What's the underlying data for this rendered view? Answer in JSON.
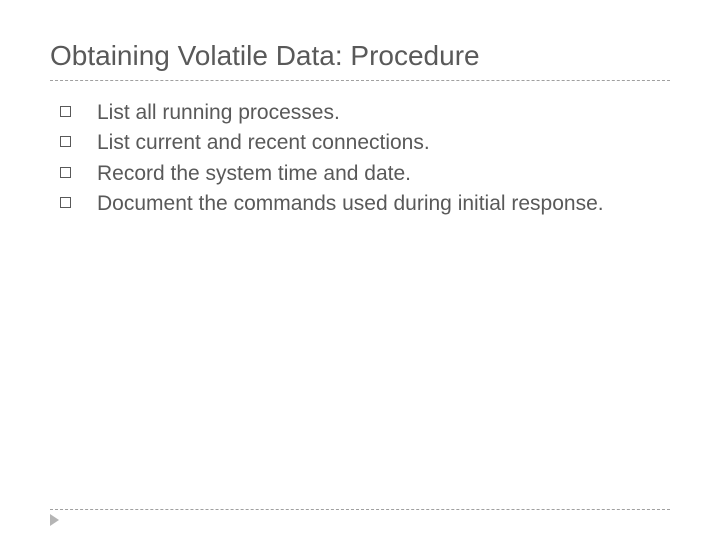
{
  "slide": {
    "title": "Obtaining Volatile Data: Procedure",
    "bullets": [
      "List all running processes.",
      "List current and recent connections.",
      "Record the system time and date.",
      "Document the commands used during initial response."
    ]
  }
}
